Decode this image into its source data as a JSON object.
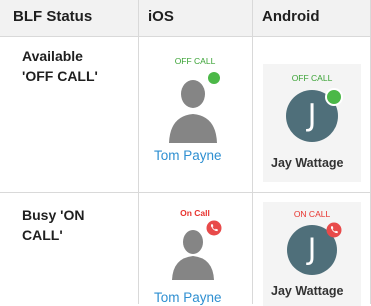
{
  "header": {
    "col_status": "BLF Status",
    "col_ios": "iOS",
    "col_android": "Android"
  },
  "rows": [
    {
      "status": "Available\n'OFF CALL'",
      "ios": {
        "caption": "OFF CALL",
        "name": "Tom Payne",
        "badge": "green-dot-icon"
      },
      "android": {
        "caption": "OFF CALL",
        "initial": "J",
        "name": "Jay Wattage",
        "badge": "green-dot-icon"
      }
    },
    {
      "status": "Busy 'ON\nCALL'",
      "ios": {
        "caption": "On Call",
        "name": "Tom Payne",
        "badge": "phone-badge-icon"
      },
      "android": {
        "caption": "ON CALL",
        "initial": "J",
        "name": "Jay Wattage",
        "badge": "phone-badge-icon"
      }
    }
  ],
  "colors": {
    "green_caption": "#3aa335",
    "green_dot": "#4cb848",
    "red_caption": "#e8332e",
    "red_badge": "#e84a4a",
    "avatar_blue": "#4f6f7a",
    "person_gray": "#858585",
    "link_blue": "#2e8fd1"
  }
}
